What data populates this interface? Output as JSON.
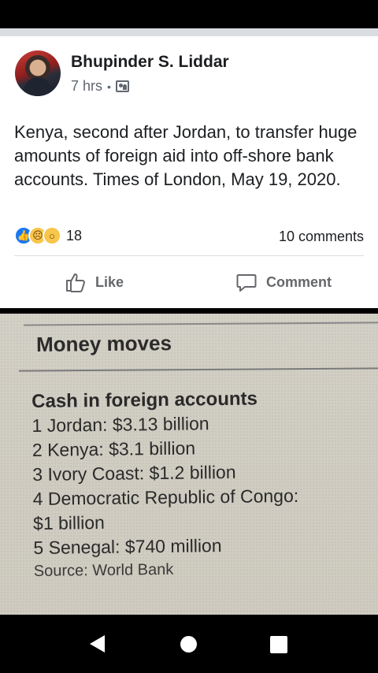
{
  "post": {
    "author": "Bhupinder S. Liddar",
    "time": "7 hrs",
    "separator": "•",
    "text": "Kenya, second after Jordan, to transfer huge amounts of foreign aid into off-shore bank accounts. Times of London, May 19, 2020.",
    "reaction_count": "18",
    "comments": "10 comments",
    "actions": {
      "like": "Like",
      "comment": "Comment"
    },
    "icons": {
      "audience": "custom-audience-icon",
      "reactions": [
        "like-icon",
        "sad-icon",
        "wow-icon"
      ]
    }
  },
  "photo": {
    "heading": "Money moves",
    "subhead": "Cash in foreign accounts",
    "items": [
      "1 Jordan: $3.13 billion",
      "2 Kenya: $3.1 billion",
      "3 Ivory Coast: $1.2 billion",
      "4 Democratic Republic of Congo:",
      "$1 billion",
      "5 Senegal: $740 million"
    ],
    "source": "Source: World Bank"
  },
  "colors": {
    "brand_blue": "#1877f2",
    "text": "#1c1e21",
    "muted": "#65676b"
  }
}
